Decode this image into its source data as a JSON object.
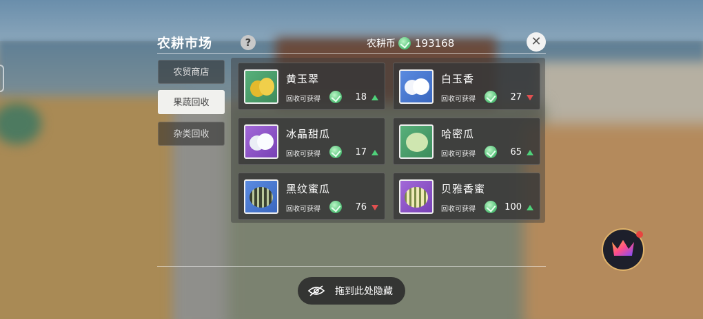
{
  "panel": {
    "title": "农耕市场",
    "help_label": "?",
    "currency": {
      "label": "农耕币",
      "value": "193168",
      "icon": "green-coin-icon"
    },
    "close_icon": "close-icon"
  },
  "tabs": [
    {
      "label": "农贸商店",
      "active": false
    },
    {
      "label": "果蔬回收",
      "active": true
    },
    {
      "label": "杂类回收",
      "active": false
    }
  ],
  "items": [
    {
      "name": "黄玉翠",
      "gain_label": "回收可获得",
      "amount": "18",
      "trend": "up",
      "bg": "green",
      "fruit_color": "#e7c23b"
    },
    {
      "name": "白玉香",
      "gain_label": "回收可获得",
      "amount": "27",
      "trend": "down",
      "bg": "blue",
      "fruit_color": "#f4f6fb"
    },
    {
      "name": "冰晶甜瓜",
      "gain_label": "回收可获得",
      "amount": "17",
      "trend": "up",
      "bg": "purple",
      "fruit_color": "#eef2f7"
    },
    {
      "name": "哈密瓜",
      "gain_label": "回收可获得",
      "amount": "65",
      "trend": "up",
      "bg": "green",
      "fruit_color": "#cfe6b0"
    },
    {
      "name": "黑纹蜜瓜",
      "gain_label": "回收可获得",
      "amount": "76",
      "trend": "down",
      "bg": "blue",
      "fruit_color": "#6d7a55"
    },
    {
      "name": "贝雅香蜜",
      "gain_label": "回收可获得",
      "amount": "100",
      "trend": "up",
      "bg": "purple",
      "fruit_color": "#e6e2b0"
    }
  ],
  "hide_bar": {
    "label": "拖到此处隐藏",
    "icon": "eye-slash-icon"
  },
  "colors": {
    "trend_up": "#4fd17a",
    "trend_down": "#e25050",
    "active_tab": "#f1f1ee"
  }
}
